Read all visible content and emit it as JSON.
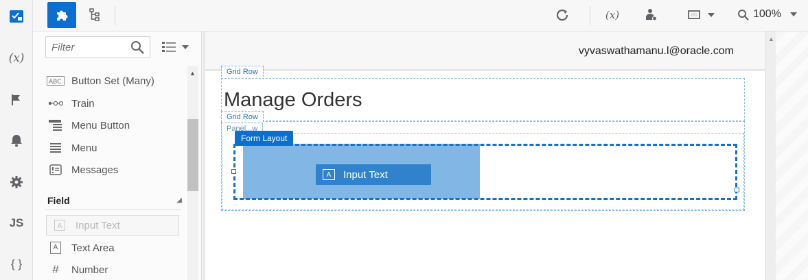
{
  "rail": {
    "variables_label": "(x)",
    "js_label": "JS",
    "json_label": "{ }"
  },
  "toolbar": {
    "zoom": "100%",
    "variables_label": "(x)"
  },
  "palette": {
    "filter_placeholder": "Filter",
    "items": [
      {
        "label": "Button Set (Many)",
        "icon": "ABC"
      },
      {
        "label": "Train",
        "icon": "train-icon"
      },
      {
        "label": "Menu Button",
        "icon": "menu-button-icon"
      },
      {
        "label": "Menu",
        "icon": "menu-icon"
      },
      {
        "label": "Messages",
        "icon": "messages-icon"
      }
    ],
    "section": "Field",
    "field_items": [
      {
        "label": "Input Text",
        "icon": "A"
      },
      {
        "label": "Text Area",
        "icon": "A"
      },
      {
        "label": "Number",
        "icon": "#"
      }
    ]
  },
  "canvas": {
    "user_email": "vyvaswathamanu.l@oracle.com",
    "grid_row_1": "Grid Row",
    "page_title": "Manage Orders",
    "grid_row_2": "Grid Row",
    "panel_tag": "Panel...w",
    "form_layout": "Form Layout",
    "drag_chip": "Input Text",
    "drag_chip_icon": "A"
  },
  "colors": {
    "accent": "#0b6fd0",
    "drop_zone": "#82b6e4",
    "chip": "#2f82cb"
  }
}
